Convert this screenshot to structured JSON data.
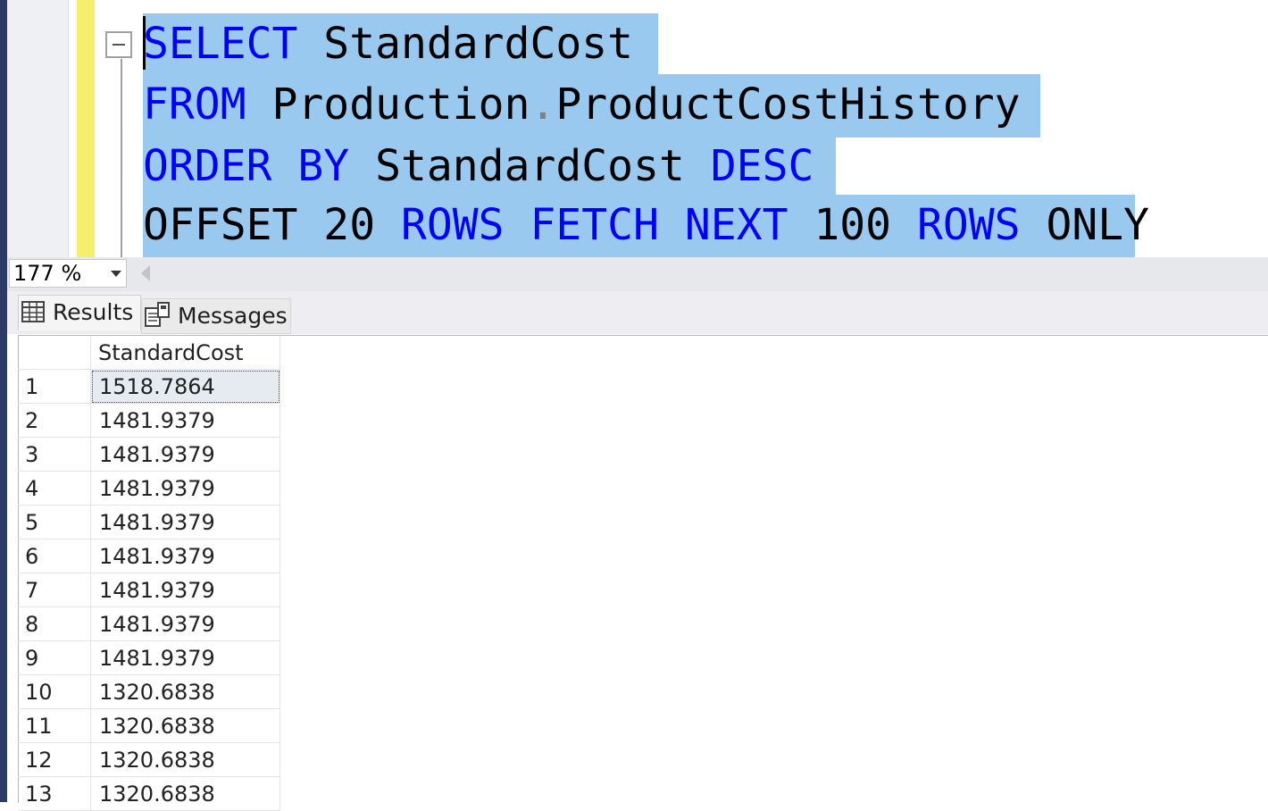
{
  "editor": {
    "lines": [
      [
        {
          "t": "SELECT",
          "kw": true
        },
        {
          "t": " StandardCost ",
          "kw": false
        }
      ],
      [
        {
          "t": "FROM",
          "kw": true
        },
        {
          "t": " Production",
          "kw": false
        },
        {
          "t": ".",
          "dot": true
        },
        {
          "t": "ProductCostHistory ",
          "kw": false
        }
      ],
      [
        {
          "t": "ORDER BY",
          "kw": true
        },
        {
          "t": " StandardCost ",
          "kw": false
        },
        {
          "t": "DESC",
          "kw": true
        },
        {
          "t": " ",
          "kw": false
        }
      ],
      [
        {
          "t": "OFFSET 20 ",
          "kw": false
        },
        {
          "t": "ROWS",
          "kw": true
        },
        {
          "t": " ",
          "kw": false
        },
        {
          "t": "FETCH",
          "kw": true
        },
        {
          "t": " ",
          "kw": false
        },
        {
          "t": "NEXT",
          "kw": true
        },
        {
          "t": " 100 ",
          "kw": false
        },
        {
          "t": "ROWS",
          "kw": true
        },
        {
          "t": " ONLY",
          "kw": false
        }
      ]
    ],
    "colors": {
      "keyword": "#0000ff",
      "text": "#000000",
      "selection": "#99c9ef"
    }
  },
  "zoom": {
    "value": "177 %"
  },
  "tabs": {
    "results": "Results",
    "messages": "Messages"
  },
  "grid": {
    "header": "StandardCost",
    "rows": [
      {
        "n": "1",
        "v": "1518.7864"
      },
      {
        "n": "2",
        "v": "1481.9379"
      },
      {
        "n": "3",
        "v": "1481.9379"
      },
      {
        "n": "4",
        "v": "1481.9379"
      },
      {
        "n": "5",
        "v": "1481.9379"
      },
      {
        "n": "6",
        "v": "1481.9379"
      },
      {
        "n": "7",
        "v": "1481.9379"
      },
      {
        "n": "8",
        "v": "1481.9379"
      },
      {
        "n": "9",
        "v": "1481.9379"
      },
      {
        "n": "10",
        "v": "1320.6838"
      },
      {
        "n": "11",
        "v": "1320.6838"
      },
      {
        "n": "12",
        "v": "1320.6838"
      },
      {
        "n": "13",
        "v": "1320.6838"
      }
    ]
  }
}
